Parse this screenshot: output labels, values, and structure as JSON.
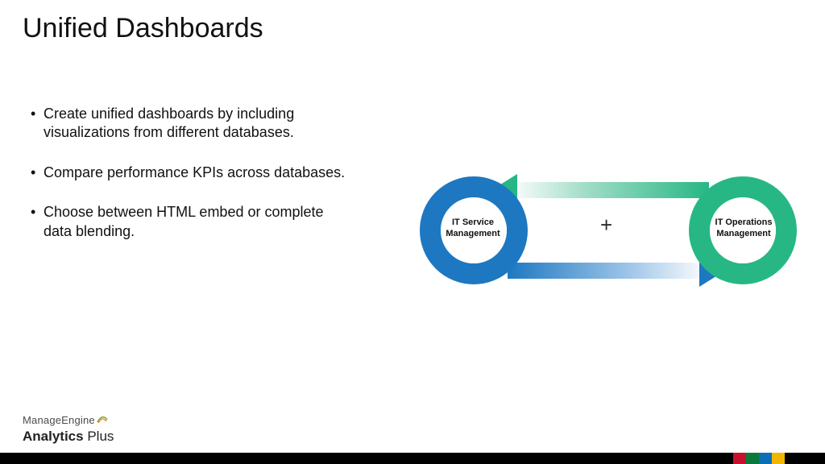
{
  "title": "Unified Dashboards",
  "bullets": [
    "Create unified dashboards by including visualizations from different databases.",
    "Compare performance KPIs across databases.",
    "Choose between HTML embed or complete data blending."
  ],
  "diagram": {
    "left_node": "IT Service Management",
    "right_node": "IT Operations Management",
    "joiner": "+",
    "colors": {
      "blue": "#1d78c1",
      "green": "#27b785"
    }
  },
  "logo": {
    "brand": "ManageEngine",
    "product_bold": "Analytics",
    "product_light": "Plus"
  },
  "footer_colors": [
    "#c8102e",
    "#0a7a3b",
    "#0b6fb8",
    "#f2b600"
  ]
}
